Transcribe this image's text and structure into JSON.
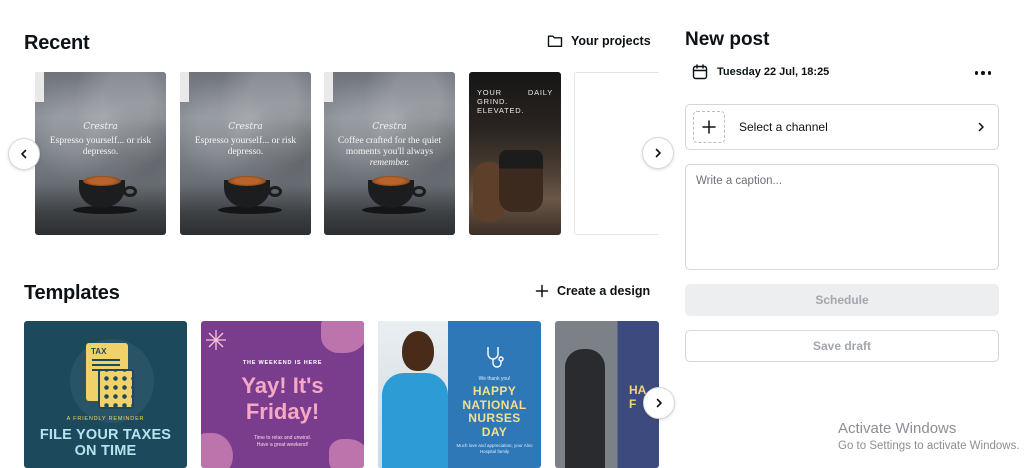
{
  "recent": {
    "title": "Recent",
    "projects_link": "Your projects",
    "items": [
      {
        "brand": "Crestra",
        "caption": "Espresso yourself... or risk depresso."
      },
      {
        "brand": "Crestra",
        "caption": "Espresso yourself... or risk depresso."
      },
      {
        "brand": "Crestra",
        "caption_a": "Coffee crafted for the quiet moments you'll always",
        "caption_b": "remember."
      },
      {
        "tagline_a": "YOUR",
        "tagline_b": "GRIND.",
        "tagline_c": "ELEVATED.",
        "daily": "DAILY"
      }
    ]
  },
  "templates": {
    "title": "Templates",
    "create_link": "Create a design",
    "tax": {
      "doc_label": "TAX",
      "reminder": "A FRIENDLY REMINDER",
      "headline_a": "FILE YOUR TAXES",
      "headline_b": "ON TIME"
    },
    "friday": {
      "kicker": "THE WEEKEND IS HERE",
      "headline_a": "Yay! It's",
      "headline_b": "Friday!",
      "note_a": "Time to relax and unwind.",
      "note_b": "Have a great weekend!"
    },
    "nurses": {
      "thanks": "We thank you!",
      "headline_a": "HAPPY",
      "headline_b": "NATIONAL",
      "headline_c": "NURSES",
      "headline_d": "DAY",
      "small": "Much love and appreciation, your Also Hospital family"
    },
    "soldier": {
      "headline_a": "HA",
      "headline_b": "F"
    }
  },
  "new_post": {
    "title": "New post",
    "date": "Tuesday 22 Jul, 18:25",
    "channel_label": "Select a channel",
    "caption_placeholder": "Write a caption...",
    "schedule_label": "Schedule",
    "draft_label": "Save draft"
  },
  "watermark": {
    "line1": "Activate Windows",
    "line2": "Go to Settings to activate Windows."
  },
  "icons": {
    "folder": "folder-icon",
    "plus": "plus-icon",
    "calendar": "calendar-icon",
    "more": "more-horizontal-icon",
    "chevron_left": "chevron-left-icon",
    "chevron_right": "chevron-right-icon"
  },
  "colors": {
    "text": "#0d1216",
    "border": "#d3d6da",
    "disabled_text": "#a2a7ad",
    "disabled_bg": "#eceef0"
  }
}
